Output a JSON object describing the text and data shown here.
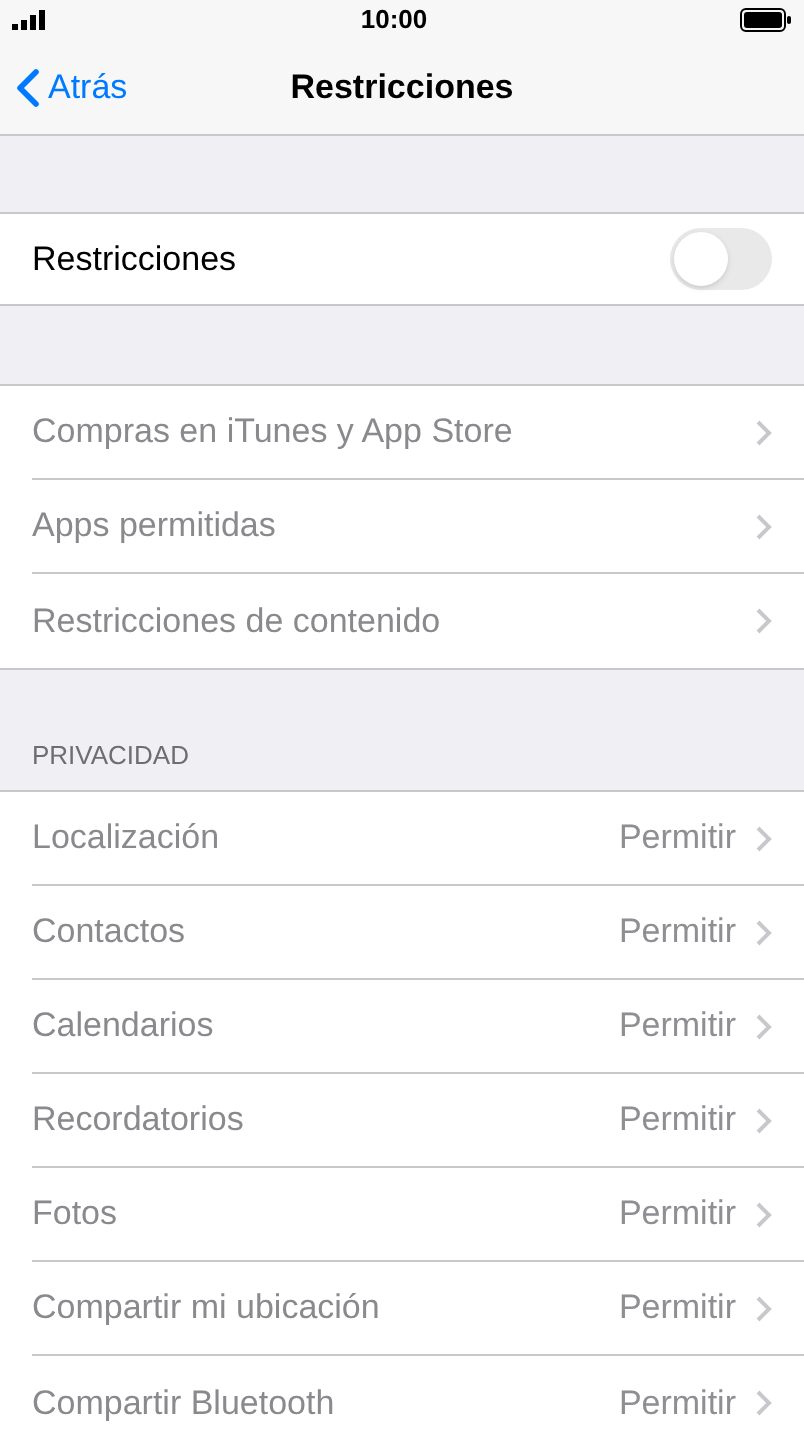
{
  "status_bar": {
    "time": "10:00"
  },
  "nav": {
    "back": "Atrás",
    "title": "Restricciones"
  },
  "master": {
    "label": "Restricciones",
    "on": false
  },
  "groups": [
    {
      "rows": [
        {
          "label": "Compras en iTunes y App Store",
          "disabled": true
        },
        {
          "label": "Apps permitidas",
          "disabled": true
        },
        {
          "label": "Restricciones de contenido",
          "disabled": true
        }
      ]
    },
    {
      "header": "PRIVACIDAD",
      "rows": [
        {
          "label": "Localización",
          "value": "Permitir",
          "disabled": true
        },
        {
          "label": "Contactos",
          "value": "Permitir",
          "disabled": true
        },
        {
          "label": "Calendarios",
          "value": "Permitir",
          "disabled": true
        },
        {
          "label": "Recordatorios",
          "value": "Permitir",
          "disabled": true
        },
        {
          "label": "Fotos",
          "value": "Permitir",
          "disabled": true
        },
        {
          "label": "Compartir mi ubicación",
          "value": "Permitir",
          "disabled": true
        },
        {
          "label": "Compartir Bluetooth",
          "value": "Permitir",
          "disabled": true
        }
      ]
    }
  ]
}
